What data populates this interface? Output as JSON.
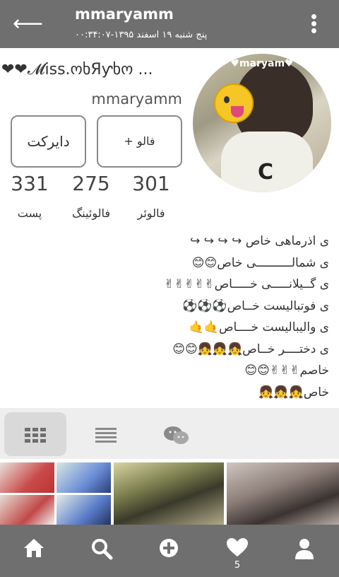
{
  "header": {
    "title": "mmaryamm",
    "subtitle": "پنج شنبه ۱۹ اسفند ۱۳۹۵-۰۰:۳۴:۰۷"
  },
  "profile": {
    "avatar_watermark": "♥maryam♥",
    "full_name": "❤❤𝓜iss.ოხЯƴხო ...",
    "username": "mmaryamm",
    "follow_label": "+ فالو",
    "direct_label": "دایرکت",
    "stats": [
      {
        "value": "301",
        "label": "فالوئر"
      },
      {
        "value": "275",
        "label": "فالوئینگ"
      },
      {
        "value": "331",
        "label": "پست"
      }
    ],
    "bio": [
      "ی اذرماهی خاص ↪ ↪ ↪ ↪",
      "ی شمالــــــــــی خاص😊😊",
      "ی گــیلانـــــی خـــــاص✌✌✌✌✌",
      "ی فوتبالیست خــاص⚽⚽⚽",
      "ی والیبالیست خــــاص🤙🤙",
      "ی دختــــر خــاص👧👧👧😊😊",
      "خاصم✌✌✌😊😊",
      "خاص👧👧👧"
    ]
  },
  "tabs": [
    {
      "name": "grid",
      "icon": "grid-icon"
    },
    {
      "name": "list",
      "icon": "list-icon"
    },
    {
      "name": "chat",
      "icon": "chat-icon"
    }
  ],
  "bottom_nav": {
    "items": [
      "home-icon",
      "search-icon",
      "add-icon",
      "heart-icon",
      "profile-icon"
    ],
    "likes_count": "5"
  },
  "colors": {
    "bar": "#6f6f6f",
    "active_tab": "#d9d9d9"
  }
}
